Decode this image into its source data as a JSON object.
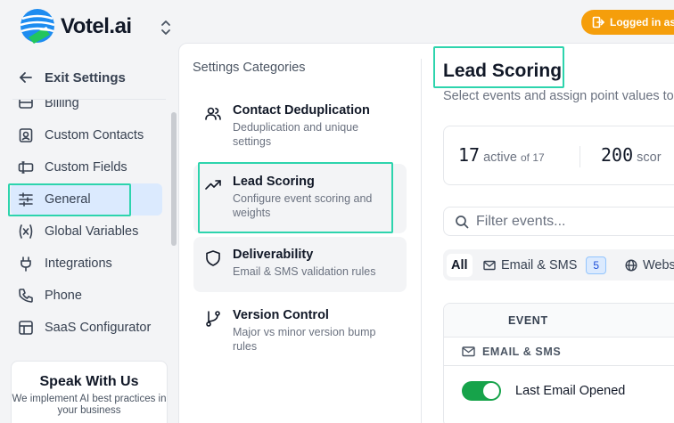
{
  "app": {
    "logo_text": "Votel.ai",
    "login_pill": "Logged in as"
  },
  "sidebar": {
    "exit_label": "Exit Settings",
    "items": [
      {
        "label": "Billing",
        "icon": "billing-icon"
      },
      {
        "label": "Custom Contacts",
        "icon": "contacts-icon"
      },
      {
        "label": "Custom Fields",
        "icon": "fields-icon"
      },
      {
        "label": "General",
        "icon": "sliders-icon",
        "active": true
      },
      {
        "label": "Global Variables",
        "icon": "variable-icon"
      },
      {
        "label": "Integrations",
        "icon": "plug-icon"
      },
      {
        "label": "Phone",
        "icon": "phone-icon"
      },
      {
        "label": "SaaS Configurator",
        "icon": "layout-icon"
      }
    ],
    "promo": {
      "title": "Speak With Us",
      "subtitle": "We implement AI best practices in your business"
    }
  },
  "categories": {
    "heading": "Settings Categories",
    "items": [
      {
        "title": "Contact Deduplication",
        "desc": "Deduplication and unique settings",
        "icon": "users-icon"
      },
      {
        "title": "Lead Scoring",
        "desc": "Configure event scoring and weights",
        "icon": "trending-up-icon",
        "selected": true
      },
      {
        "title": "Deliverability",
        "desc": "Email & SMS validation rules",
        "icon": "shield-icon"
      },
      {
        "title": "Version Control",
        "desc": "Major vs minor version bump rules",
        "icon": "git-branch-icon"
      }
    ]
  },
  "main": {
    "title": "Lead Scoring",
    "subtitle": "Select events and assign point values to",
    "stats": {
      "active_count": "17",
      "active_label": "active",
      "active_total": "of 17",
      "score_count": "200",
      "score_label": "scor"
    },
    "filter": {
      "placeholder": "Filter events..."
    },
    "tabs": {
      "all": "All",
      "email_sms": "Email & SMS",
      "email_sms_count": "5",
      "web": "Webs"
    },
    "table": {
      "header_event": "EVENT",
      "group": "EMAIL & SMS",
      "rows": [
        {
          "name": "Last Email Opened",
          "enabled": true
        }
      ]
    }
  },
  "colors": {
    "accent": "#2dd4ad",
    "login": "#f59e0b",
    "toggle_on": "#16a34a",
    "nav_active": "#dbeafe"
  }
}
